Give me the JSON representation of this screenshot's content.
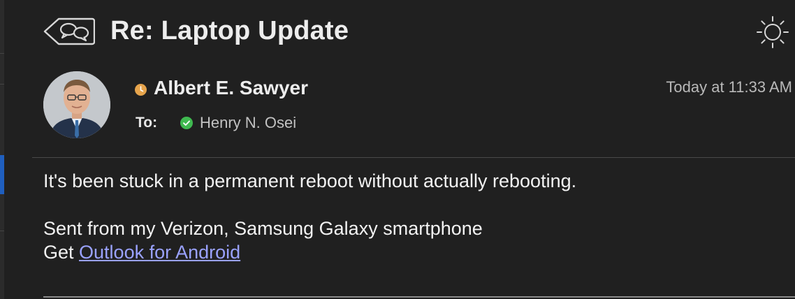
{
  "header": {
    "subject": "Re: Laptop Update",
    "thread_icon": "conversation-icon",
    "theme_icon": "sun-icon"
  },
  "sender": {
    "name": "Albert E. Sawyer",
    "presence": "away",
    "presence_color": "#e6a44c",
    "timestamp": "Today at 11:33 AM"
  },
  "recipients": {
    "label": "To:",
    "name": "Henry N. Osei",
    "presence": "available",
    "presence_color": "#3fb950"
  },
  "body": {
    "line1": "It's been stuck in a permanent reboot without actually rebooting.",
    "line2": "Sent from my Verizon, Samsung Galaxy smartphone",
    "get_prefix": "Get ",
    "link_text": "Outlook for Android",
    "link_color": "#9aa2ff"
  }
}
